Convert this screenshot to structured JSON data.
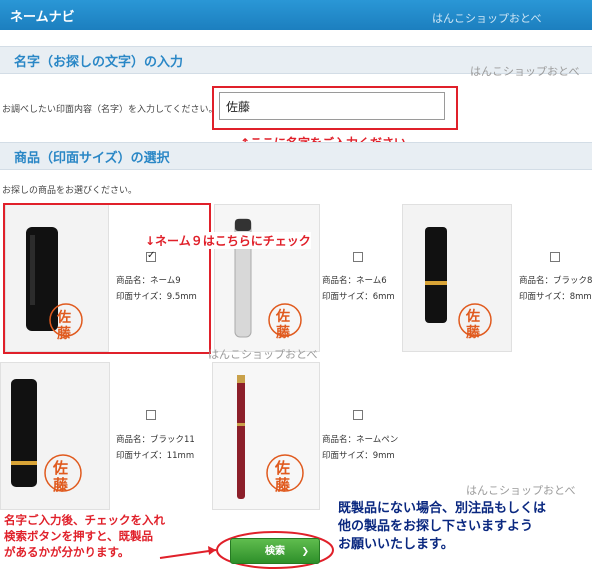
{
  "header": {
    "title": "ネームナビ",
    "watermark": "はんこショップおとべ"
  },
  "section_name": {
    "title": "名字（お探しの文字）の入力",
    "watermark": "はんこショップおとべ",
    "prompt": "お調べしたい印面内容（名字）を入力してください。",
    "input_value": "佐藤",
    "annotation": "↑ここに名字をご入力ください"
  },
  "section_product": {
    "title": "商品（印面サイズ）の選択",
    "prompt": "お探しの商品をお選びください。",
    "annotation": "↓ネーム９はこちらにチェック",
    "watermark_mid": "はんこショップおとべ",
    "watermark_bottom": "はんこショップおとべ"
  },
  "products": [
    {
      "name": "商品名：ネーム9",
      "size": "印面サイズ：9.5mm",
      "checked": true,
      "stamp_char_1": "佐",
      "stamp_char_2": "藤"
    },
    {
      "name": "商品名：ネーム6",
      "size": "印面サイズ：6mm",
      "checked": false,
      "stamp_char_1": "佐",
      "stamp_char_2": "藤"
    },
    {
      "name": "商品名：ブラック8",
      "size": "印面サイズ：8mm",
      "checked": false,
      "stamp_char_1": "佐",
      "stamp_char_2": "藤"
    },
    {
      "name": "商品名：ブラック11",
      "size": "印面サイズ：11mm",
      "checked": false,
      "stamp_char_1": "佐",
      "stamp_char_2": "藤"
    },
    {
      "name": "商品名：ネームペン",
      "size": "印面サイズ：9mm",
      "checked": false,
      "stamp_char_1": "佐",
      "stamp_char_2": "藤"
    }
  ],
  "search_button": {
    "label": "検索",
    "arrow": "❯"
  },
  "note_left": [
    "名字ご入力後、チェックを入れ",
    "検索ボタンを押すと、既製品",
    "があるかが分かります。"
  ],
  "note_right": [
    "既製品にない場合、別注品もしくは",
    "他の製品をお探し下さいますよう",
    "お願いいたします。"
  ],
  "colors": {
    "accent_blue": "#2a87c6",
    "annotation_red": "#e0202a",
    "note_blue": "#0a2880",
    "button_green": "#3fa637",
    "stamp_red": "#e05a1e"
  }
}
